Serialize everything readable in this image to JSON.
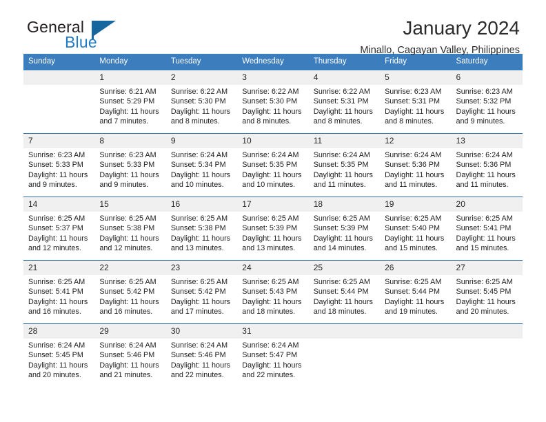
{
  "brand": {
    "word_one": "General",
    "word_two": "Blue",
    "flag_color": "#17679f",
    "blue_text_color": "#1f7ac7"
  },
  "header": {
    "title": "January 2024",
    "subtitle": "Minallo, Cagayan Valley, Philippines"
  },
  "theme": {
    "header_blue": "#3b7dbd",
    "separator_blue": "#2a6ead",
    "number_band": "#f0f0f0"
  },
  "calendar": {
    "weekday_headers": [
      "Sunday",
      "Monday",
      "Tuesday",
      "Wednesday",
      "Thursday",
      "Friday",
      "Saturday"
    ],
    "weeks": [
      {
        "days": [
          {
            "number": "",
            "lines": [
              "",
              "",
              "",
              ""
            ]
          },
          {
            "number": "1",
            "lines": [
              "Sunrise: 6:21 AM",
              "Sunset: 5:29 PM",
              "Daylight: 11 hours",
              "and 7 minutes."
            ]
          },
          {
            "number": "2",
            "lines": [
              "Sunrise: 6:22 AM",
              "Sunset: 5:30 PM",
              "Daylight: 11 hours",
              "and 8 minutes."
            ]
          },
          {
            "number": "3",
            "lines": [
              "Sunrise: 6:22 AM",
              "Sunset: 5:30 PM",
              "Daylight: 11 hours",
              "and 8 minutes."
            ]
          },
          {
            "number": "4",
            "lines": [
              "Sunrise: 6:22 AM",
              "Sunset: 5:31 PM",
              "Daylight: 11 hours",
              "and 8 minutes."
            ]
          },
          {
            "number": "5",
            "lines": [
              "Sunrise: 6:23 AM",
              "Sunset: 5:31 PM",
              "Daylight: 11 hours",
              "and 8 minutes."
            ]
          },
          {
            "number": "6",
            "lines": [
              "Sunrise: 6:23 AM",
              "Sunset: 5:32 PM",
              "Daylight: 11 hours",
              "and 9 minutes."
            ]
          }
        ]
      },
      {
        "days": [
          {
            "number": "7",
            "lines": [
              "Sunrise: 6:23 AM",
              "Sunset: 5:33 PM",
              "Daylight: 11 hours",
              "and 9 minutes."
            ]
          },
          {
            "number": "8",
            "lines": [
              "Sunrise: 6:23 AM",
              "Sunset: 5:33 PM",
              "Daylight: 11 hours",
              "and 9 minutes."
            ]
          },
          {
            "number": "9",
            "lines": [
              "Sunrise: 6:24 AM",
              "Sunset: 5:34 PM",
              "Daylight: 11 hours",
              "and 10 minutes."
            ]
          },
          {
            "number": "10",
            "lines": [
              "Sunrise: 6:24 AM",
              "Sunset: 5:35 PM",
              "Daylight: 11 hours",
              "and 10 minutes."
            ]
          },
          {
            "number": "11",
            "lines": [
              "Sunrise: 6:24 AM",
              "Sunset: 5:35 PM",
              "Daylight: 11 hours",
              "and 11 minutes."
            ]
          },
          {
            "number": "12",
            "lines": [
              "Sunrise: 6:24 AM",
              "Sunset: 5:36 PM",
              "Daylight: 11 hours",
              "and 11 minutes."
            ]
          },
          {
            "number": "13",
            "lines": [
              "Sunrise: 6:24 AM",
              "Sunset: 5:36 PM",
              "Daylight: 11 hours",
              "and 11 minutes."
            ]
          }
        ]
      },
      {
        "days": [
          {
            "number": "14",
            "lines": [
              "Sunrise: 6:25 AM",
              "Sunset: 5:37 PM",
              "Daylight: 11 hours",
              "and 12 minutes."
            ]
          },
          {
            "number": "15",
            "lines": [
              "Sunrise: 6:25 AM",
              "Sunset: 5:38 PM",
              "Daylight: 11 hours",
              "and 12 minutes."
            ]
          },
          {
            "number": "16",
            "lines": [
              "Sunrise: 6:25 AM",
              "Sunset: 5:38 PM",
              "Daylight: 11 hours",
              "and 13 minutes."
            ]
          },
          {
            "number": "17",
            "lines": [
              "Sunrise: 6:25 AM",
              "Sunset: 5:39 PM",
              "Daylight: 11 hours",
              "and 13 minutes."
            ]
          },
          {
            "number": "18",
            "lines": [
              "Sunrise: 6:25 AM",
              "Sunset: 5:39 PM",
              "Daylight: 11 hours",
              "and 14 minutes."
            ]
          },
          {
            "number": "19",
            "lines": [
              "Sunrise: 6:25 AM",
              "Sunset: 5:40 PM",
              "Daylight: 11 hours",
              "and 15 minutes."
            ]
          },
          {
            "number": "20",
            "lines": [
              "Sunrise: 6:25 AM",
              "Sunset: 5:41 PM",
              "Daylight: 11 hours",
              "and 15 minutes."
            ]
          }
        ]
      },
      {
        "days": [
          {
            "number": "21",
            "lines": [
              "Sunrise: 6:25 AM",
              "Sunset: 5:41 PM",
              "Daylight: 11 hours",
              "and 16 minutes."
            ]
          },
          {
            "number": "22",
            "lines": [
              "Sunrise: 6:25 AM",
              "Sunset: 5:42 PM",
              "Daylight: 11 hours",
              "and 16 minutes."
            ]
          },
          {
            "number": "23",
            "lines": [
              "Sunrise: 6:25 AM",
              "Sunset: 5:42 PM",
              "Daylight: 11 hours",
              "and 17 minutes."
            ]
          },
          {
            "number": "24",
            "lines": [
              "Sunrise: 6:25 AM",
              "Sunset: 5:43 PM",
              "Daylight: 11 hours",
              "and 18 minutes."
            ]
          },
          {
            "number": "25",
            "lines": [
              "Sunrise: 6:25 AM",
              "Sunset: 5:44 PM",
              "Daylight: 11 hours",
              "and 18 minutes."
            ]
          },
          {
            "number": "26",
            "lines": [
              "Sunrise: 6:25 AM",
              "Sunset: 5:44 PM",
              "Daylight: 11 hours",
              "and 19 minutes."
            ]
          },
          {
            "number": "27",
            "lines": [
              "Sunrise: 6:25 AM",
              "Sunset: 5:45 PM",
              "Daylight: 11 hours",
              "and 20 minutes."
            ]
          }
        ]
      },
      {
        "days": [
          {
            "number": "28",
            "lines": [
              "Sunrise: 6:24 AM",
              "Sunset: 5:45 PM",
              "Daylight: 11 hours",
              "and 20 minutes."
            ]
          },
          {
            "number": "29",
            "lines": [
              "Sunrise: 6:24 AM",
              "Sunset: 5:46 PM",
              "Daylight: 11 hours",
              "and 21 minutes."
            ]
          },
          {
            "number": "30",
            "lines": [
              "Sunrise: 6:24 AM",
              "Sunset: 5:46 PM",
              "Daylight: 11 hours",
              "and 22 minutes."
            ]
          },
          {
            "number": "31",
            "lines": [
              "Sunrise: 6:24 AM",
              "Sunset: 5:47 PM",
              "Daylight: 11 hours",
              "and 22 minutes."
            ]
          },
          {
            "number": "",
            "lines": [
              "",
              "",
              "",
              ""
            ]
          },
          {
            "number": "",
            "lines": [
              "",
              "",
              "",
              ""
            ]
          },
          {
            "number": "",
            "lines": [
              "",
              "",
              "",
              ""
            ]
          }
        ]
      }
    ]
  }
}
